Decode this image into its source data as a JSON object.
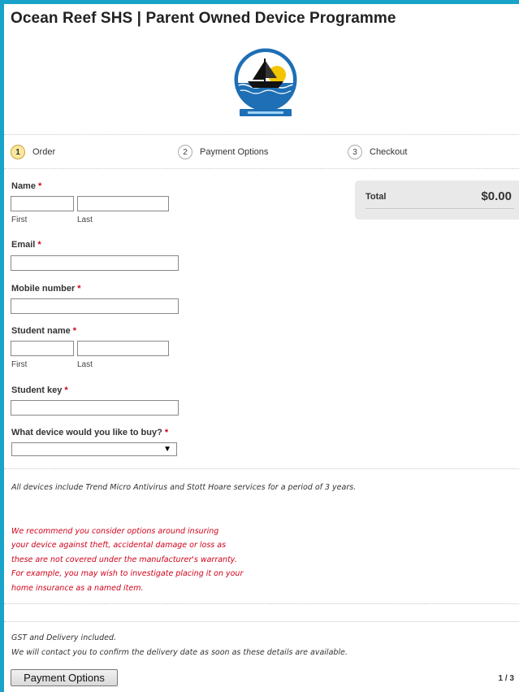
{
  "header": {
    "title": "Ocean Reef SHS | Parent Owned Device Programme"
  },
  "steps": [
    {
      "num": "1",
      "label": "Order"
    },
    {
      "num": "2",
      "label": "Payment Options"
    },
    {
      "num": "3",
      "label": "Checkout"
    }
  ],
  "form": {
    "required_mark": "*",
    "name": {
      "label": "Name",
      "first_sub": "First",
      "last_sub": "Last"
    },
    "email": {
      "label": "Email"
    },
    "mobile": {
      "label": "Mobile number"
    },
    "student_name": {
      "label": "Student name",
      "first_sub": "First",
      "last_sub": "Last"
    },
    "student_key": {
      "label": "Student key"
    },
    "device": {
      "label": "What device would you like to buy?",
      "selected": ""
    }
  },
  "summary": {
    "total_label": "Total",
    "total_value": "$0.00"
  },
  "notes": {
    "antivirus": "All devices include Trend Micro Antivirus and Stott Hoare services for a period of 3 years.",
    "insurance_lines": [
      "We recommend you consider options around insuring",
      "your device against theft, accidental damage or loss as",
      "these are not covered under the manufacturer's warranty.",
      "For example, you may wish to investigate placing it on your",
      "home insurance as a named item."
    ],
    "gst": "GST and Delivery included.",
    "contact": "We will contact you to confirm the delivery date as soon as these details are available."
  },
  "footer": {
    "button_label": "Payment Options",
    "pager": "1 / 3"
  },
  "colors": {
    "frame": "#1aa3c8",
    "required": "#d0021b",
    "warning_text": "#d0021b",
    "active_step": "#fbe8a0"
  }
}
